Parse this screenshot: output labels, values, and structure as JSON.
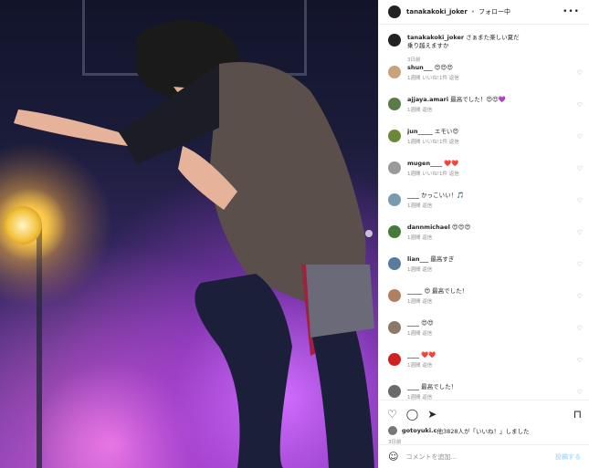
{
  "header": {
    "username": "tanakakoki_joker",
    "separator": "•",
    "follow_label": "フォロー中",
    "more_icon": "•••"
  },
  "caption": {
    "username": "tanakakoki_joker",
    "text": "さぁまた楽しい夏だ\n乗り越えますか",
    "time": "3日前"
  },
  "comments": [
    {
      "user": "shun___",
      "text": "😍😍😍",
      "meta": "1週間 いいね!1件 返信",
      "color": "#c9a27a"
    },
    {
      "user": "ajjaya.amari",
      "text": "最高でした！😍😍💜",
      "meta": "1週間 返信",
      "color": "#5a7a4a"
    },
    {
      "user": "jun_____",
      "text": "エモい😍",
      "meta": "1週間 いいね!1件 返信",
      "color": "#6a8a3a"
    },
    {
      "user": "mugen____",
      "text": "❤️❤️",
      "meta": "1週間 いいね!1件 返信",
      "color": "#9a9a9a"
    },
    {
      "user": "____",
      "text": "かっこいい！🎵",
      "meta": "1週間 返信",
      "color": "#7a9ab0"
    },
    {
      "user": "dannmichael",
      "text": "😍😍😍",
      "meta": "1週間 返信",
      "color": "#4a7a3a"
    },
    {
      "user": "lian___",
      "text": "最高すぎ",
      "meta": "1週間 返信",
      "color": "#5a7aa0"
    },
    {
      "user": "_____",
      "text": "😍 最高でした！",
      "meta": "1週間 返信",
      "color": "#b08060"
    },
    {
      "user": "____",
      "text": "😍😍",
      "meta": "1週間 返信",
      "color": "#8a7a6a"
    },
    {
      "user": "____",
      "text": "❤️❤️",
      "meta": "1週間 返信",
      "color": "#d02020"
    },
    {
      "user": "____",
      "text": "最高でした！",
      "meta": "1週間 返信",
      "color": "#6a6a6a"
    }
  ],
  "actions": {
    "like_icon": "♡",
    "comment_icon": "◯",
    "share_icon": "➤",
    "save_icon": "⊓"
  },
  "likes": {
    "user": "gotoyuki.c",
    "text": "他3828人が「いいね！」しました"
  },
  "post_time": "3日前",
  "add_comment": {
    "emoji_icon": "☺",
    "placeholder": "コメントを追加...",
    "post_label": "投稿する"
  }
}
